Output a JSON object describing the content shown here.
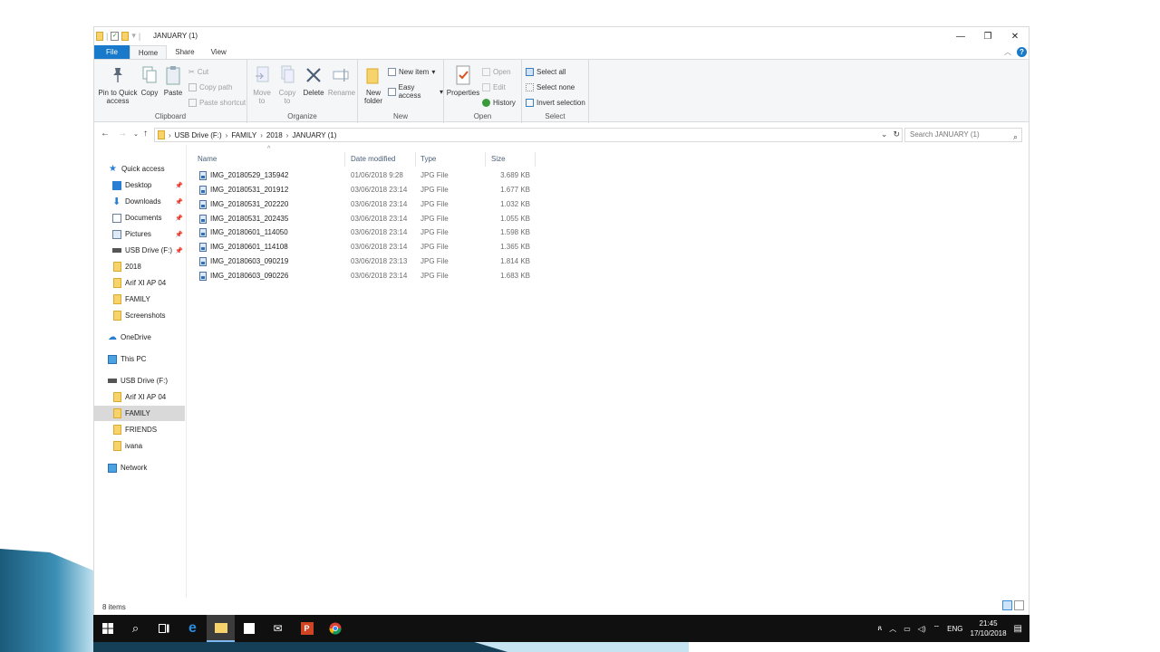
{
  "window": {
    "title": "JANUARY (1)"
  },
  "ribbon_tabs": [
    "File",
    "Home",
    "Share",
    "View"
  ],
  "ribbon": {
    "clipboard": {
      "pin": "Pin to Quick access",
      "copy": "Copy",
      "paste": "Paste",
      "cut": "Cut",
      "copy_path": "Copy path",
      "paste_shortcut": "Paste shortcut",
      "label": "Clipboard"
    },
    "organize": {
      "move_to": "Move to",
      "copy_to": "Copy to",
      "delete": "Delete",
      "rename": "Rename",
      "label": "Organize"
    },
    "new": {
      "new_folder": "New folder",
      "new_item": "New item",
      "easy_access": "Easy access",
      "label": "New"
    },
    "open": {
      "properties": "Properties",
      "open": "Open",
      "edit": "Edit",
      "history": "History",
      "label": "Open"
    },
    "select": {
      "select_all": "Select all",
      "select_none": "Select none",
      "invert": "Invert selection",
      "label": "Select"
    }
  },
  "address": {
    "crumbs": [
      "USB Drive (F:)",
      "FAMILY",
      "2018",
      "JANUARY (1)"
    ],
    "search_placeholder": "Search JANUARY (1)"
  },
  "nav": {
    "quick_access": "Quick access",
    "desktop": "Desktop",
    "downloads": "Downloads",
    "documents": "Documents",
    "pictures": "Pictures",
    "usb_pinned": "USB Drive (F:)",
    "folder_2018": "2018",
    "arif1": "Arif XI AP 04",
    "family1": "FAMILY",
    "screenshots": "Screenshots",
    "onedrive": "OneDrive",
    "thispc": "This PC",
    "usb": "USB Drive (F:)",
    "arif2": "Arif XI AP 04",
    "family2": "FAMILY",
    "friends": "FRIENDS",
    "ivana": "ivana",
    "network": "Network"
  },
  "columns": {
    "name": "Name",
    "date": "Date modified",
    "type": "Type",
    "size": "Size"
  },
  "files": [
    {
      "name": "IMG_20180529_135942",
      "date": "01/06/2018 9:28",
      "type": "JPG File",
      "size": "3.689 KB"
    },
    {
      "name": "IMG_20180531_201912",
      "date": "03/06/2018 23:14",
      "type": "JPG File",
      "size": "1.677 KB"
    },
    {
      "name": "IMG_20180531_202220",
      "date": "03/06/2018 23:14",
      "type": "JPG File",
      "size": "1.032 KB"
    },
    {
      "name": "IMG_20180531_202435",
      "date": "03/06/2018 23:14",
      "type": "JPG File",
      "size": "1.055 KB"
    },
    {
      "name": "IMG_20180601_114050",
      "date": "03/06/2018 23:14",
      "type": "JPG File",
      "size": "1.598 KB"
    },
    {
      "name": "IMG_20180601_114108",
      "date": "03/06/2018 23:14",
      "type": "JPG File",
      "size": "1.365 KB"
    },
    {
      "name": "IMG_20180603_090219",
      "date": "03/06/2018 23:13",
      "type": "JPG File",
      "size": "1.814 KB"
    },
    {
      "name": "IMG_20180603_090226",
      "date": "03/06/2018 23:14",
      "type": "JPG File",
      "size": "1.683 KB"
    }
  ],
  "status": {
    "items": "8 items"
  },
  "taskbar": {
    "lang": "ENG",
    "time": "21:45",
    "date": "17/10/2018"
  },
  "colors": {
    "file_tab": "#1979ca",
    "selection": "#d9d9d9",
    "taskbar": "#101010",
    "folder": "#f6d36b"
  }
}
